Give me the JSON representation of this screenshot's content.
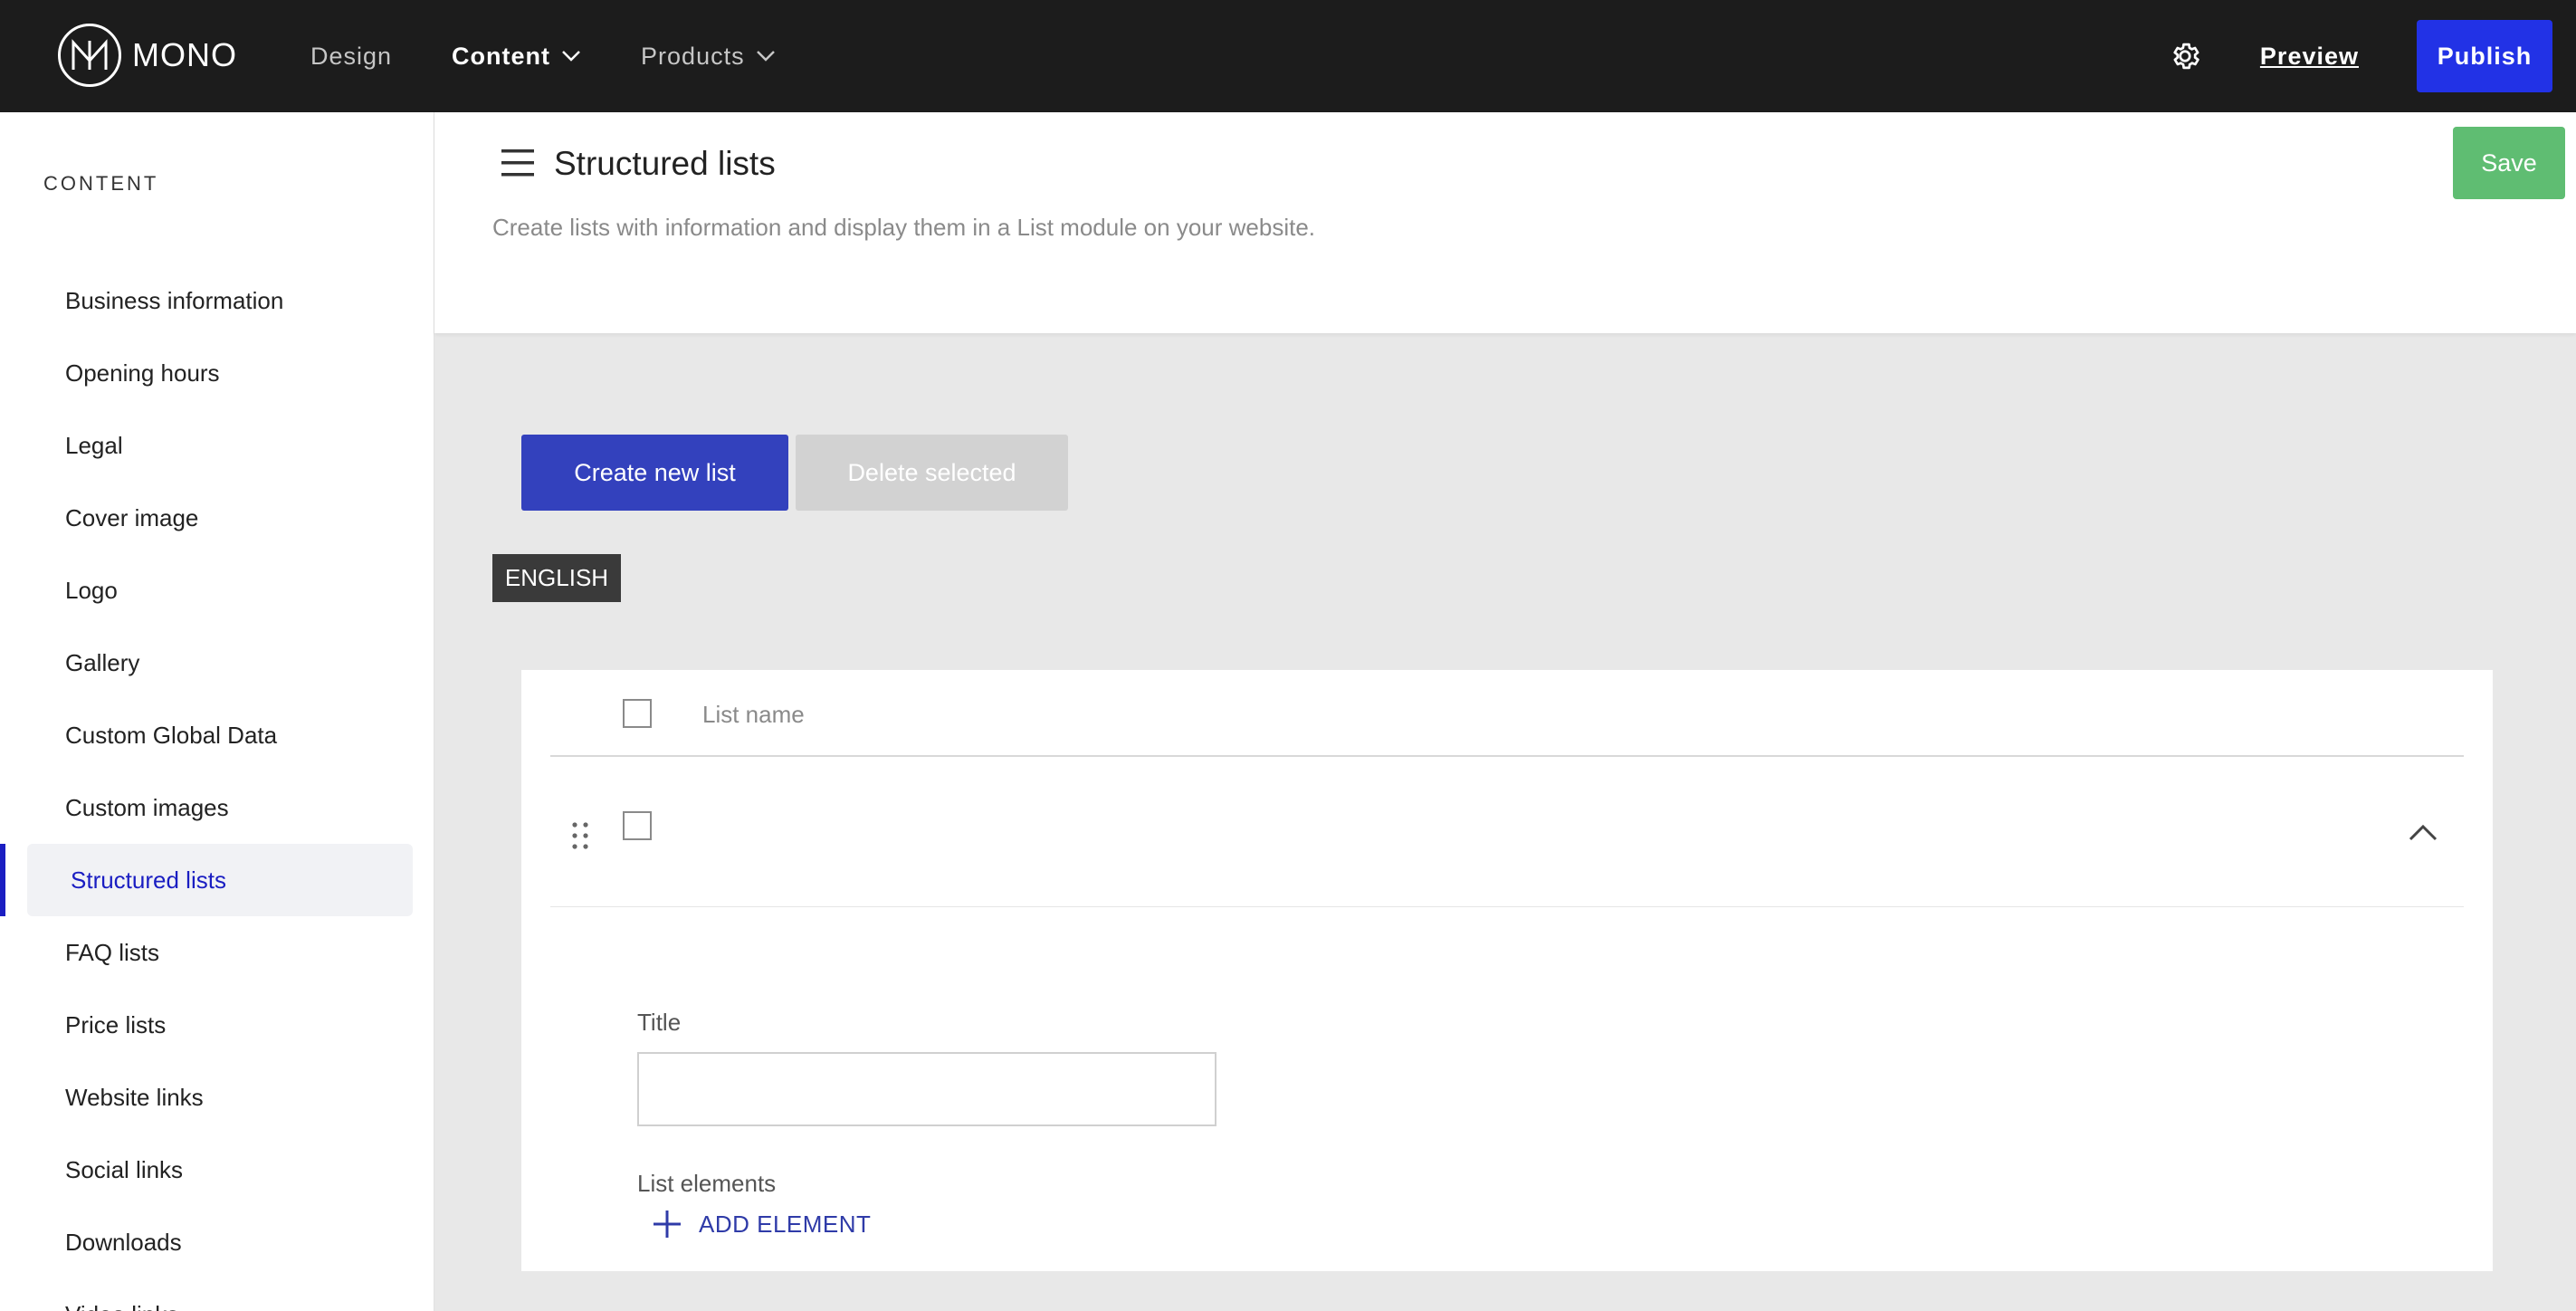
{
  "brand": {
    "name": "MONO"
  },
  "nav": {
    "items": [
      {
        "label": "Design",
        "active": false,
        "dropdown": false
      },
      {
        "label": "Content",
        "active": true,
        "dropdown": true
      },
      {
        "label": "Products",
        "active": false,
        "dropdown": true
      }
    ],
    "preview_label": "Preview",
    "publish_label": "Publish"
  },
  "sidebar": {
    "heading": "CONTENT",
    "items": [
      {
        "label": "Business information"
      },
      {
        "label": "Opening hours"
      },
      {
        "label": "Legal"
      },
      {
        "label": "Cover image"
      },
      {
        "label": "Logo"
      },
      {
        "label": "Gallery"
      },
      {
        "label": "Custom Global Data"
      },
      {
        "label": "Custom images"
      },
      {
        "label": "Structured lists",
        "active": true
      },
      {
        "label": "FAQ lists"
      },
      {
        "label": "Price lists"
      },
      {
        "label": "Website links"
      },
      {
        "label": "Social links"
      },
      {
        "label": "Downloads"
      },
      {
        "label": "Video links"
      }
    ]
  },
  "header": {
    "title": "Structured lists",
    "description": "Create lists with information and display them in a List module on your website.",
    "save_label": "Save"
  },
  "actions": {
    "create_label": "Create new list",
    "delete_label": "Delete selected"
  },
  "language": {
    "label": "ENGLISH"
  },
  "table": {
    "column_header": "List name",
    "rows": [
      {
        "name": "",
        "expanded": true,
        "title_label": "Title",
        "title_value": "",
        "elements_label": "List elements",
        "add_element_label": "ADD ELEMENT"
      }
    ]
  },
  "colors": {
    "topbar": "#1c1c1c",
    "publish": "#2232e6",
    "save": "#5fbd72",
    "primary": "#3341bd",
    "active_nav": "#1a1ec2"
  }
}
